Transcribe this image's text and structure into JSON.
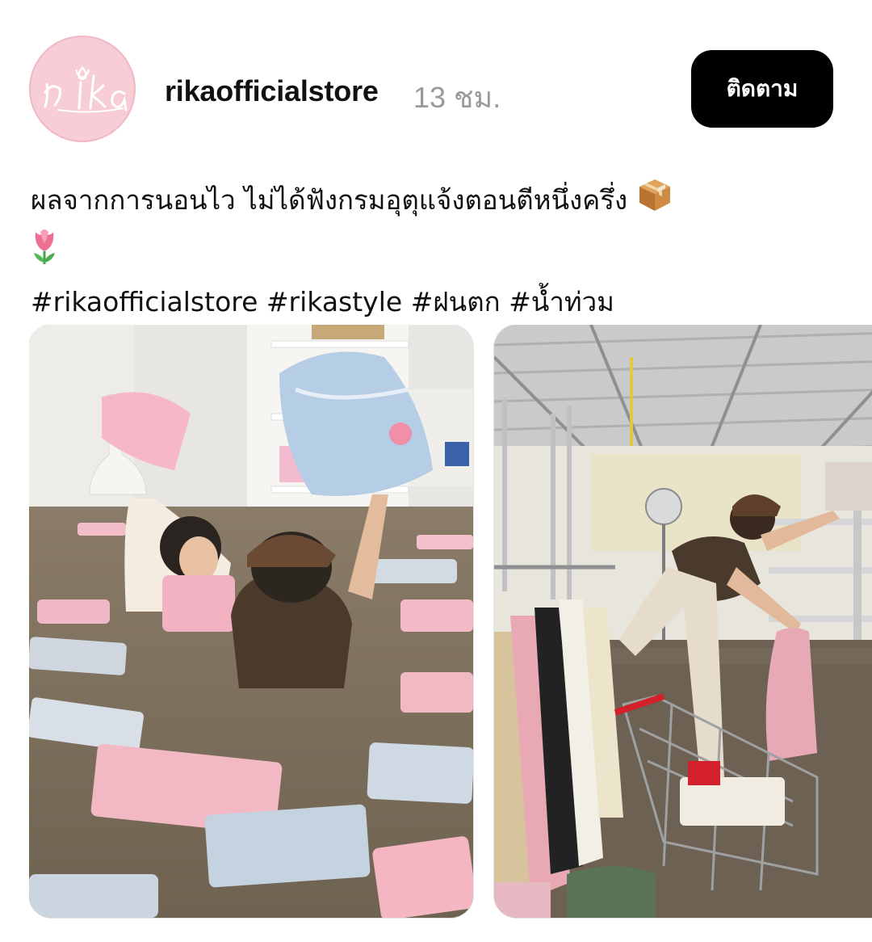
{
  "post": {
    "username": "rikaofficialstore",
    "timestamp": "13 ชม.",
    "follow_label": "ติดตาม",
    "avatar_logo_text": "rika",
    "caption_line1": "ผลจากการนอนไว ไม่ได้ฟังกรมอุตุแจ้งตอนตีหนึ่งครึ่ง",
    "hashtags": [
      "#rikaofficialstore",
      "#rikastyle",
      "#ฝนตก",
      "#น้ำท่วม"
    ],
    "caption_emojis": [
      "package-icon",
      "tulip-icon"
    ]
  },
  "media": [
    {
      "name": "flooded-store-photo"
    },
    {
      "name": "flooded-warehouse-photo"
    }
  ],
  "colors": {
    "follow_bg": "#000000",
    "timestamp": "#9a9a9a",
    "avatar_bg": "#f7cdd6"
  }
}
